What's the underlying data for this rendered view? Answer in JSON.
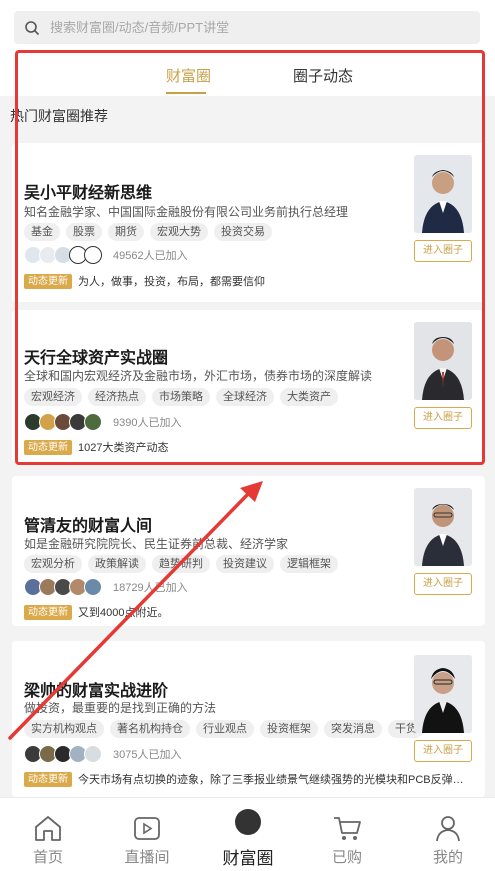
{
  "search": {
    "placeholder": "搜索财富圈/动态/音频/PPT讲堂"
  },
  "tabs": [
    {
      "label": "财富圈"
    },
    {
      "label": "圈子动态"
    }
  ],
  "section_title": "热门财富圈推荐",
  "join_label": "进入圈子",
  "update_badge": "动态更新",
  "cards": [
    {
      "title": "吴小平财经新思维",
      "desc": "知名金融学家、中国国际金融股份有限公司业务前执行总经理",
      "tags": [
        "基金",
        "股票",
        "期货",
        "宏观大势",
        "投资交易"
      ],
      "members": "49562人已加入",
      "update": "为人，做事，投资，布局，都需要信仰"
    },
    {
      "title": "天行全球资产实战圈",
      "desc": "全球和国内宏观经济及金融市场，外汇市场，债券市场的深度解读",
      "tags": [
        "宏观经济",
        "经济热点",
        "市场策略",
        "全球经济",
        "大类资产"
      ],
      "members": "9390人已加入",
      "update": "1027大类资产动态"
    },
    {
      "title": "管清友的财富人间",
      "desc": "如是金融研究院院长、民生证券前总裁、经济学家",
      "tags": [
        "宏观分析",
        "政策解读",
        "趋势研判",
        "投资建议",
        "逻辑框架"
      ],
      "members": "18729人已加入",
      "update": "又到4000点附近。"
    },
    {
      "title": "梁帅的财富实战进阶",
      "desc": "做投资，最重要的是找到正确的方法",
      "tags": [
        "实方机构观点",
        "著名机构持仓",
        "行业观点",
        "投资框架",
        "突发消息",
        "干货"
      ],
      "members": "3075人已加入",
      "update": "今天市场有点切换的迹象，除了三季报业绩景气继续强势的光模块和PCB反弹强势外..."
    }
  ],
  "nav": [
    {
      "label": "首页",
      "icon": "home-icon"
    },
    {
      "label": "直播间",
      "icon": "live-icon"
    },
    {
      "label": "财富圈",
      "icon": "wealth-circle-icon"
    },
    {
      "label": "已购",
      "icon": "cart-icon"
    },
    {
      "label": "我的",
      "icon": "profile-icon"
    }
  ],
  "colors": {
    "accent": "#c9a048",
    "badge": "#d9a94a",
    "highlight": "#e53935"
  }
}
